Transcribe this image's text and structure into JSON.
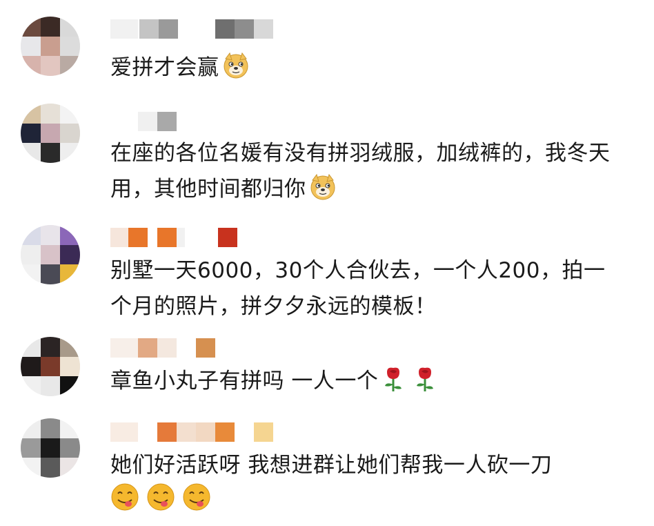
{
  "comments": [
    {
      "text": "爱拼才会赢",
      "emojis": [
        "doge-emoji"
      ]
    },
    {
      "text": "在座的各位名媛有没有拼羽绒服，加绒裤的，我冬天用，其他时间都归你",
      "emojis": [
        "doge-emoji"
      ]
    },
    {
      "text": "别墅一天6000，30个人合伙去，一个人200，拍一个月的照片，拼夕夕永远的模板！",
      "emojis": []
    },
    {
      "text": "章鱼小丸子有拼吗 一人一个",
      "emojis": [
        "rose-emoji",
        "rose-emoji"
      ]
    },
    {
      "text": "她们好活跃呀 我想进群让她们帮我一人砍一刀",
      "emojis": [
        "yummy-face-emoji",
        "yummy-face-emoji",
        "yummy-face-emoji"
      ]
    }
  ],
  "colors": {
    "text": "#1a1a1a",
    "doge": "#f2c25a",
    "rose_petal": "#d0202a",
    "rose_leaf": "#3a8f3a",
    "yummy_face": "#f5b82e",
    "tongue": "#e8505b"
  }
}
